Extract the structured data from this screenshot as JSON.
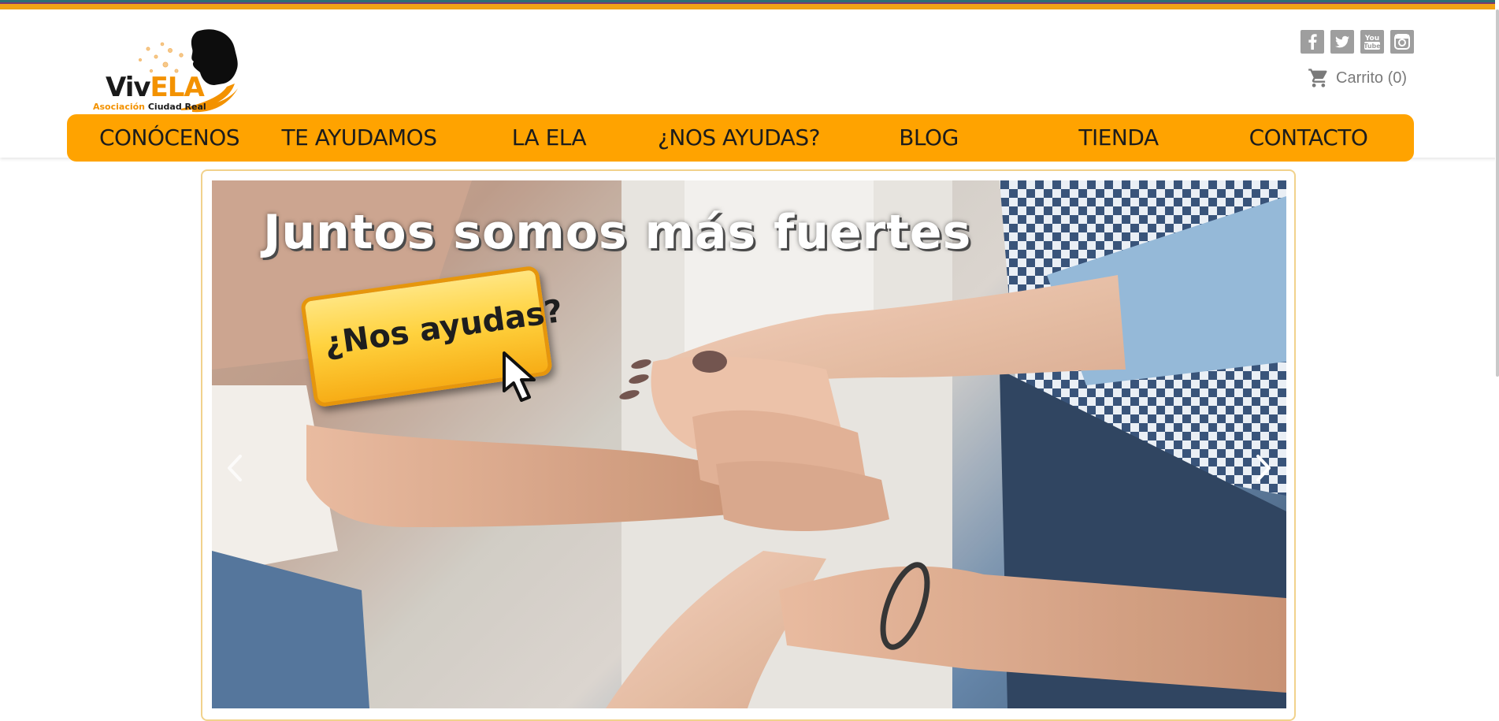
{
  "brand": {
    "wordmark_part1": "Viv",
    "wordmark_part2": "ELA",
    "subline_part1": "Asociación",
    "subline_part2": "Ciudad Real",
    "accent_color": "#f39200"
  },
  "header": {
    "social": [
      {
        "name": "facebook",
        "icon": "facebook-icon"
      },
      {
        "name": "twitter",
        "icon": "twitter-icon"
      },
      {
        "name": "youtube",
        "icon": "youtube-icon"
      },
      {
        "name": "instagram",
        "icon": "instagram-icon"
      }
    ],
    "cart_label": "Carrito (0)"
  },
  "nav": {
    "background_color": "#ffa300",
    "items": [
      {
        "label": "CONÓCENOS"
      },
      {
        "label": "TE AYUDAMOS"
      },
      {
        "label": "LA ELA"
      },
      {
        "label": "¿NOS AYUDAS?"
      },
      {
        "label": "BLOG"
      },
      {
        "label": "TIENDA"
      },
      {
        "label": "CONTACTO"
      }
    ]
  },
  "slider": {
    "headline": "Juntos somos más fuertes",
    "cta_label": "¿Nos ayudas?",
    "prev_icon": "chevron-left-icon",
    "next_icon": "chevron-right-icon"
  }
}
